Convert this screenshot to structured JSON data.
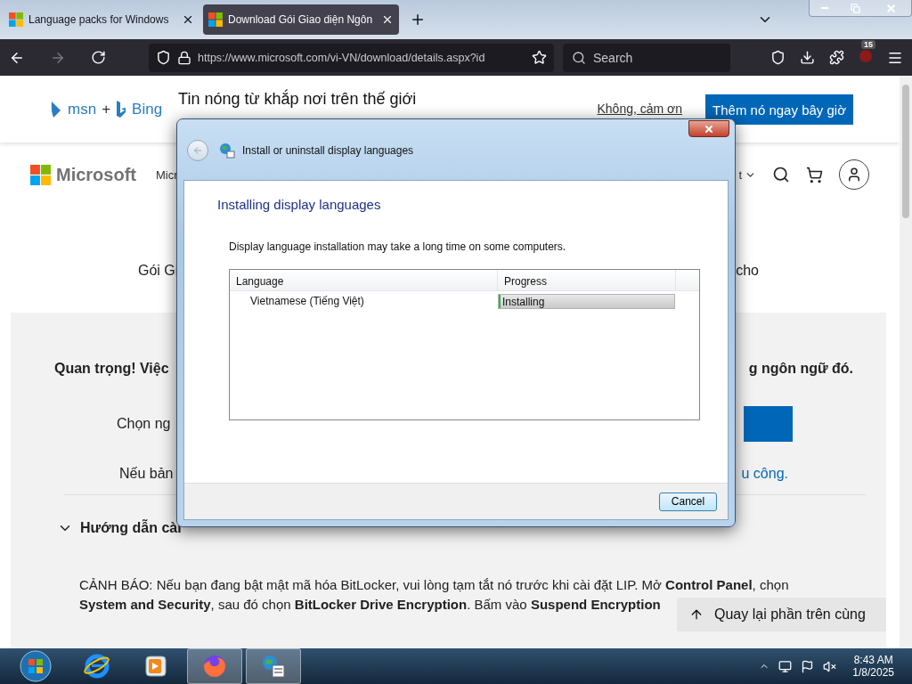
{
  "browser": {
    "tabs": [
      {
        "title": "Language packs for Windows",
        "selected": false
      },
      {
        "title": "Download Gói Giao diện Ngôn",
        "selected": true
      }
    ],
    "url": "https://www.microsoft.com/vi-VN/download/details.aspx?id",
    "search_placeholder": "Search",
    "badge": "15"
  },
  "banner": {
    "msn": "msn",
    "plus": "+",
    "bing": "Bing",
    "headline": "Tin nóng từ khắp nơi trên thế giới",
    "decline_link": "Không, cảm ơn",
    "accept_button": "Thêm nó ngay bây giờ"
  },
  "header": {
    "brand": "Microsoft",
    "nav_left": "Micr",
    "nav_right": "t"
  },
  "page": {
    "intro_left": "Gói Gi",
    "intro_right": "cho",
    "notice_left": "Quan trọng! Việc",
    "notice_right": "g ngôn ngữ đó.",
    "choose_left": "Chọn ng",
    "if_left": "Nếu bản",
    "if_link": "u công.",
    "section_title": "Hướng dẫn cài",
    "section_expanded": true,
    "warning_lines": [
      "CẢNH BÁO: Nếu bạn đang bật mật mã hóa BitLocker, vui lòng tạm tắt nó trước khi cài đặt LIP. Mở **Control Panel**, chọn",
      "**System and Security**, sau đó chọn **BitLocker Drive Encryption**. Bấm vào **Suspend Encryption**"
    ],
    "back_to_top": "Quay lại phần trên cùng"
  },
  "dialog": {
    "title": "Install or uninstall display languages",
    "heading": "Installing display languages",
    "description": "Display language installation may take a long time on some computers.",
    "columns": [
      "Language",
      "Progress"
    ],
    "rows": [
      {
        "language": "Vietnamese (Tiếng Việt)",
        "status": "Installing",
        "level": 0.01
      }
    ],
    "cancel": "Cancel"
  },
  "taskbar": {
    "apps": [
      {
        "kind": "ie",
        "active": false
      },
      {
        "kind": "media",
        "active": false
      },
      {
        "kind": "firefox",
        "active": true
      },
      {
        "kind": "control-panel",
        "active": true
      }
    ],
    "time": "8:43 AM",
    "date": "1/8/2025"
  }
}
